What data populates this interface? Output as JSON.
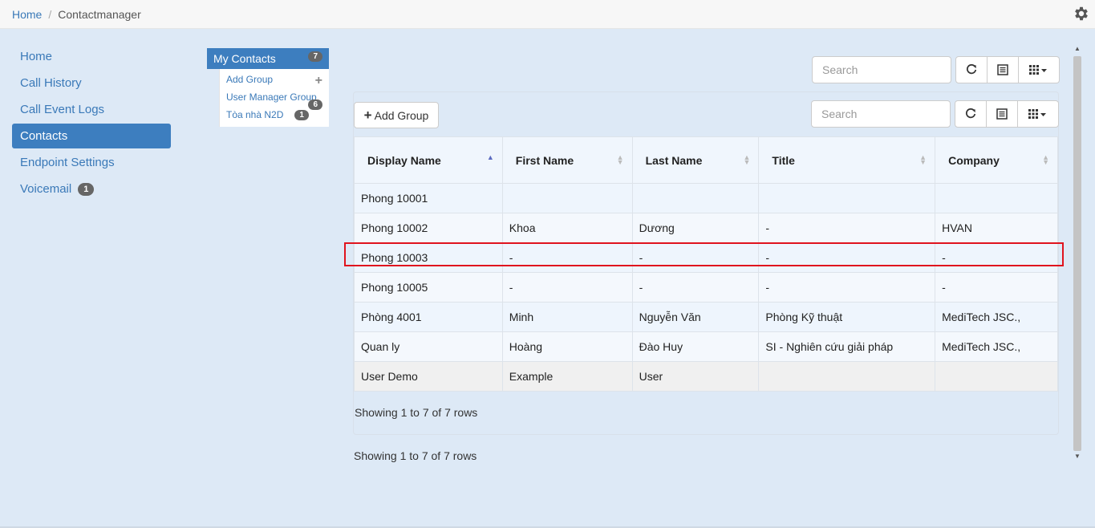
{
  "breadcrumb": {
    "home": "Home",
    "separator": "/",
    "current": "Contactmanager"
  },
  "settings_icon": "gear-icon",
  "sidebar": {
    "items": [
      {
        "label": "Home"
      },
      {
        "label": "Call History"
      },
      {
        "label": "Call Event Logs"
      },
      {
        "label": "Contacts",
        "active": true
      },
      {
        "label": "Endpoint Settings"
      },
      {
        "label": "Voicemail",
        "badge": "1"
      }
    ]
  },
  "groups": {
    "header": "My Contacts",
    "header_badge": "7",
    "items": [
      {
        "label": "Add Group"
      },
      {
        "label": "User Manager Group"
      },
      {
        "label": "Tòa nhà N2D",
        "badge": "1",
        "badge2": "6"
      }
    ]
  },
  "outer_toolbar": {
    "search_placeholder": "Search"
  },
  "inner_toolbar": {
    "add_group": "Add Group",
    "search_placeholder": "Search"
  },
  "table": {
    "columns": [
      "Display Name",
      "First Name",
      "Last Name",
      "Title",
      "Company"
    ],
    "sorted_column": "Display Name",
    "rows": [
      [
        "Phong 10001",
        "",
        "",
        "",
        ""
      ],
      [
        "Phong 10002",
        "Khoa",
        "Dương",
        "-",
        "HVAN"
      ],
      [
        "Phong 10003",
        "-",
        "-",
        "-",
        "-"
      ],
      [
        "Phong 10005",
        "-",
        "-",
        "-",
        "-"
      ],
      [
        "Phòng 4001",
        "Minh",
        "Nguyễn Văn",
        "Phòng Kỹ thuật",
        "MediTech JSC.,"
      ],
      [
        "Quan ly",
        "Hoàng",
        "Đào Huy",
        "SI - Nghiên cứu giải pháp",
        "MediTech JSC.,"
      ],
      [
        "User Demo",
        "Example",
        "User",
        "",
        ""
      ]
    ],
    "highlighted_row": "Phong 10003"
  },
  "pagination": {
    "inner": "Showing 1 to 7 of 7 rows",
    "outer": "Showing 1 to 7 of 7 rows"
  },
  "colors": {
    "accent": "#3d7ebf",
    "highlight": "#e0141e",
    "background": "#dde9f6"
  }
}
